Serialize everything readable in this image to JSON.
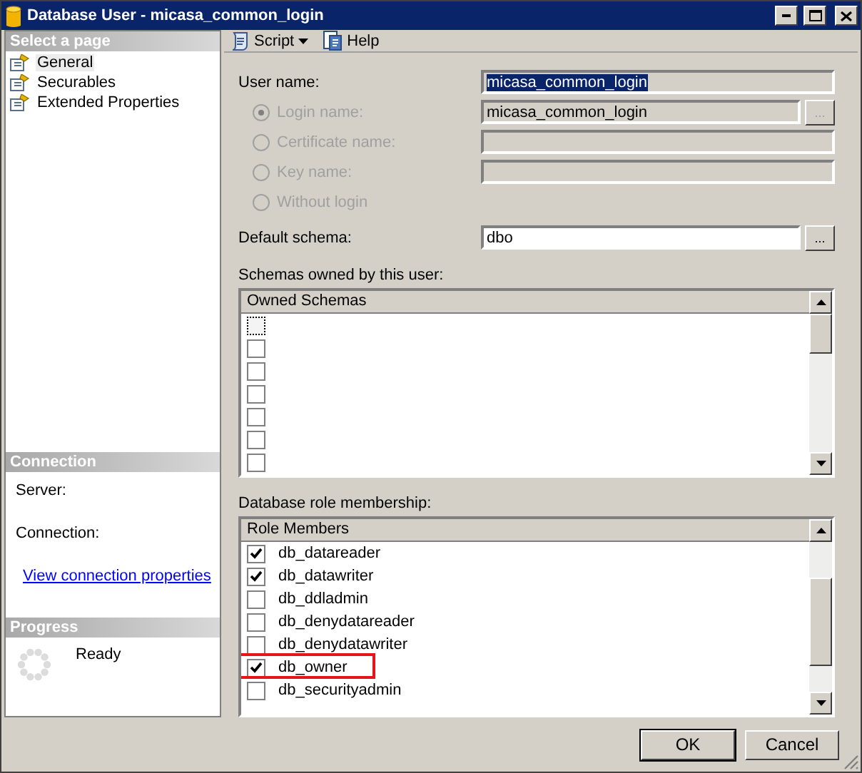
{
  "window": {
    "title": "Database User - micasa_common_login"
  },
  "sidebar": {
    "header": "Select a page",
    "items": [
      {
        "label": "General",
        "selected": true
      },
      {
        "label": "Securables",
        "selected": false
      },
      {
        "label": "Extended Properties",
        "selected": false
      }
    ]
  },
  "connection": {
    "header": "Connection",
    "server_label": "Server:",
    "connection_label": "Connection:",
    "link": "View connection properties"
  },
  "progress": {
    "header": "Progress",
    "status": "Ready"
  },
  "toolbar": [
    {
      "label": "Script",
      "kind": "dropdown"
    },
    {
      "label": "Help",
      "kind": "button"
    }
  ],
  "user_name": {
    "label": "User name:",
    "value": "micasa_common_login",
    "text_selected": true
  },
  "user_types": [
    {
      "label": "Login name:",
      "selected": true,
      "disabled": true,
      "kind": "browse",
      "value": "micasa_common_login",
      "browse": "..."
    },
    {
      "label": "Certificate name:",
      "selected": false,
      "disabled": true,
      "kind": "field"
    },
    {
      "label": "Key name:",
      "selected": false,
      "disabled": true,
      "kind": "field"
    },
    {
      "label": "Without login",
      "selected": false,
      "disabled": true,
      "kind": "none"
    }
  ],
  "default_schema": {
    "label": "Default schema:",
    "value": "dbo",
    "browse": "..."
  },
  "owned_schemas": {
    "label": "Schemas owned by this user:",
    "column": "Owned Schemas",
    "rows": [
      {
        "checked": false,
        "focused": true
      },
      {
        "checked": false,
        "focused": false
      },
      {
        "checked": false,
        "focused": false
      },
      {
        "checked": false,
        "focused": false
      },
      {
        "checked": false,
        "focused": false
      },
      {
        "checked": false,
        "focused": false
      },
      {
        "checked": false,
        "focused": false
      }
    ]
  },
  "role_membership": {
    "label": "Database role membership:",
    "column": "Role Members",
    "rows": [
      {
        "name": "db_datareader",
        "checked": true,
        "highlighted": false
      },
      {
        "name": "db_datawriter",
        "checked": true,
        "highlighted": false
      },
      {
        "name": "db_ddladmin",
        "checked": false,
        "highlighted": false
      },
      {
        "name": "db_denydatareader",
        "checked": false,
        "highlighted": false
      },
      {
        "name": "db_denydatawriter",
        "checked": false,
        "highlighted": false
      },
      {
        "name": "db_owner",
        "checked": true,
        "highlighted": true
      },
      {
        "name": "db_securityadmin",
        "checked": false,
        "highlighted": false
      }
    ]
  },
  "buttons": [
    {
      "label": "OK",
      "default": true
    },
    {
      "label": "Cancel",
      "default": false
    }
  ]
}
